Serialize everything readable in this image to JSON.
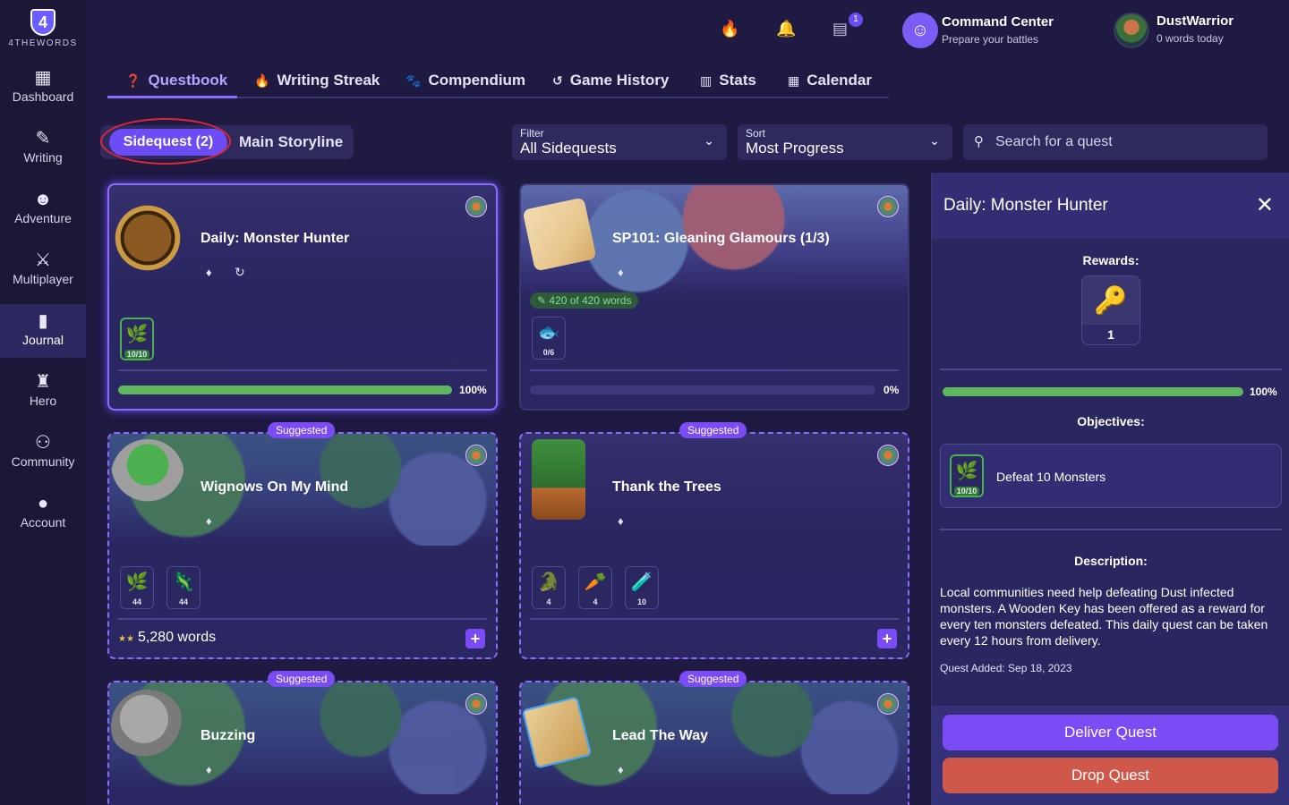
{
  "app": {
    "logo_number": "4",
    "logo_text": "4THEWORDS"
  },
  "sidebar": {
    "items": [
      {
        "label": "Dashboard",
        "icon": "dashboard-icon"
      },
      {
        "label": "Writing",
        "icon": "writing-icon"
      },
      {
        "label": "Adventure",
        "icon": "adventure-icon"
      },
      {
        "label": "Multiplayer",
        "icon": "multiplayer-icon"
      },
      {
        "label": "Journal",
        "icon": "journal-icon",
        "active": true
      },
      {
        "label": "Hero",
        "icon": "hero-icon"
      },
      {
        "label": "Community",
        "icon": "community-icon"
      },
      {
        "label": "Account",
        "icon": "account-icon"
      }
    ]
  },
  "topbar": {
    "notification_count": "1",
    "command_center": {
      "title": "Command Center",
      "subtitle": "Prepare your battles"
    },
    "user": {
      "name": "DustWarrior",
      "subtitle": "0 words today"
    }
  },
  "tabs": [
    {
      "label": "Questbook",
      "active": true
    },
    {
      "label": "Writing Streak"
    },
    {
      "label": "Compendium"
    },
    {
      "label": "Game History"
    },
    {
      "label": "Stats"
    },
    {
      "label": "Calendar"
    }
  ],
  "filters": {
    "segment_active": "Sidequest (2)",
    "segment_other": "Main Storyline",
    "filter": {
      "label": "Filter",
      "value": "All Sidequests"
    },
    "sort": {
      "label": "Sort",
      "value": "Most Progress"
    },
    "search_placeholder": "Search for a quest"
  },
  "quests": [
    {
      "title": "Daily: Monster Hunter",
      "tiles": [
        "10/10"
      ],
      "progress_label": "100%",
      "progress": 1.0
    },
    {
      "title": "SP101: Gleaning Glamours (1/3)",
      "pill": "420 of 420 words",
      "tiles": [
        "0/6"
      ],
      "progress_label": "0%",
      "progress": 0.0
    },
    {
      "title": "Wignows On My Mind",
      "badge": "Suggested",
      "tiles": [
        "44",
        "44"
      ],
      "words": "5,280 words"
    },
    {
      "title": "Thank the Trees",
      "badge": "Suggested",
      "tiles": [
        "4",
        "4",
        "10"
      ]
    },
    {
      "title": "Buzzing",
      "badge": "Suggested"
    },
    {
      "title": "Lead The Way",
      "badge": "Suggested"
    }
  ],
  "detail": {
    "title": "Daily: Monster Hunter",
    "rewards_label": "Rewards:",
    "reward_count": "1",
    "progress_label": "100%",
    "progress": 1.0,
    "objectives_label": "Objectives:",
    "objective": {
      "text": "Defeat 10 Monsters",
      "count": "10/10"
    },
    "description_label": "Description:",
    "description": "Local communities need help defeating Dust infected monsters. A Wooden Key has been offered as a reward for every ten monsters defeated. This daily quest can be taken every 12 hours from delivery.",
    "added": "Quest Added: Sep 18, 2023",
    "deliver_label": "Deliver Quest",
    "drop_label": "Drop Quest"
  },
  "colors": {
    "background": "#1e1a42",
    "sidebar": "#1a1836",
    "accent": "#7b4cf5",
    "progress": "#5fb65f",
    "drop": "#d0584a",
    "highlight_ring": "#e0253a"
  }
}
